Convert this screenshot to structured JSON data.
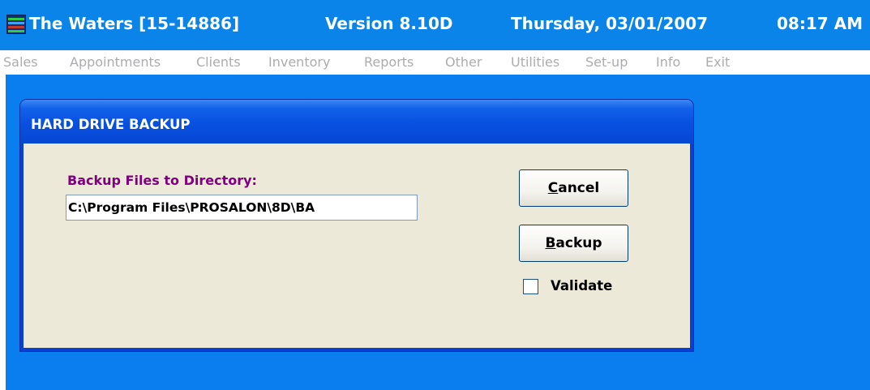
{
  "titlebar": {
    "app_title": "The Waters [15-14886]",
    "version": "Version 8.10D",
    "date": "Thursday, 03/01/2007",
    "time": "08:17 AM"
  },
  "menu": {
    "items": [
      {
        "label": "Sales"
      },
      {
        "label": "Appointments"
      },
      {
        "label": "Clients"
      },
      {
        "label": "Inventory"
      },
      {
        "label": "Reports"
      },
      {
        "label": "Other"
      },
      {
        "label": "Utilities"
      },
      {
        "label": "Set-up"
      },
      {
        "label": "Info"
      },
      {
        "label": "Exit"
      }
    ]
  },
  "dialog": {
    "title": "HARD DRIVE BACKUP",
    "directory_label": "Backup Files to Directory:",
    "directory_value": "C:\\Program Files\\PROSALON\\8D\\BA",
    "cancel": {
      "mnemonic": "C",
      "rest": "ancel"
    },
    "backup": {
      "mnemonic": "B",
      "rest": "ackup"
    },
    "validate_label": "Validate",
    "validate_checked": false
  },
  "colors": {
    "titlebar_bg": "#0a84e8",
    "workspace_bg": "#0b7eef",
    "menu_text_disabled": "#acacb0",
    "dialog_face": "#ece9d8",
    "label_purple": "#800080"
  },
  "icons": {
    "app_icon": "app-logo-icon"
  }
}
